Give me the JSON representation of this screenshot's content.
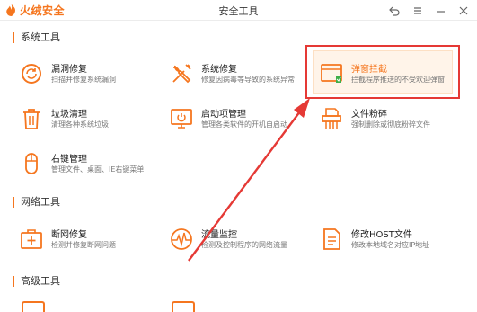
{
  "app": {
    "name": "火绒安全",
    "window_title": "安全工具"
  },
  "colors": {
    "accent": "#f5761f",
    "annotation": "#e53935"
  },
  "icons": {
    "logo": "flame-logo-icon",
    "back": "back-icon",
    "menu": "menu-icon",
    "minimize": "minimize-icon",
    "close": "close-icon"
  },
  "sections": {
    "system": {
      "title": "系统工具"
    },
    "network": {
      "title": "网络工具"
    },
    "advanced": {
      "title": "高级工具"
    }
  },
  "tools": {
    "leak_repair": {
      "name": "漏洞修复",
      "desc": "扫描并修复系统漏洞",
      "icon": "refresh-icon"
    },
    "sys_repair": {
      "name": "系统修复",
      "desc": "修复因病毒等导致的系统异常",
      "icon": "wrench-icon"
    },
    "popup_block": {
      "name": "弹窗拦截",
      "desc": "拦截程序推送的不受欢迎弹窗",
      "icon": "popup-window-icon"
    },
    "junk_clean": {
      "name": "垃圾清理",
      "desc": "清理各种系统垃圾",
      "icon": "trash-icon"
    },
    "startup": {
      "name": "启动项管理",
      "desc": "管理各类软件的开机自启动",
      "icon": "power-monitor-icon"
    },
    "shredder": {
      "name": "文件粉碎",
      "desc": "强制删除或彻底粉碎文件",
      "icon": "shredder-icon"
    },
    "context_menu": {
      "name": "右键管理",
      "desc": "管理文件、桌面、IE右键菜单",
      "icon": "mouse-icon"
    },
    "net_repair": {
      "name": "断网修复",
      "desc": "检测并修复断网问题",
      "icon": "first-aid-icon"
    },
    "traffic": {
      "name": "流量监控",
      "desc": "检测及控制程序的网络流量",
      "icon": "pulse-icon"
    },
    "hosts": {
      "name": "修改HOST文件",
      "desc": "修改本地域名对应IP地址",
      "icon": "document-icon"
    }
  }
}
